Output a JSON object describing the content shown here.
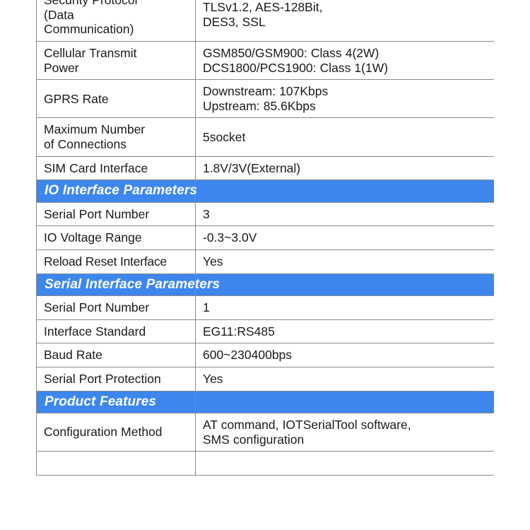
{
  "document": {
    "type": "product-specification-table",
    "accent_color": "#3d86ee",
    "border_color": "#8a8a8a",
    "text_color": "#1a1a1a",
    "banner_text_color": "#ffffff"
  },
  "rows": [
    {
      "kind": "spec",
      "label_lines": [
        "Security Protocol",
        "(Data",
        "Communication)"
      ],
      "value_lines": [
        "TLSv1.2, AES-128Bit,",
        "DES3, SSL"
      ]
    },
    {
      "kind": "spec",
      "label_lines": [
        "Cellular Transmit",
        "Power"
      ],
      "value_lines": [
        "GSM850/GSM900: Class 4(2W)",
        "DCS1800/PCS1900: Class 1(1W)"
      ]
    },
    {
      "kind": "spec",
      "label_lines": [
        "GPRS Rate"
      ],
      "value_lines": [
        "Downstream: 107Kbps",
        "Upstream: 85.6Kbps"
      ]
    },
    {
      "kind": "spec",
      "label_lines": [
        "Maximum Number",
        "of Connections"
      ],
      "value_lines": [
        "5socket"
      ]
    },
    {
      "kind": "spec",
      "label_lines": [
        "SIM Card Interface"
      ],
      "value_lines": [
        "1.8V/3V(External)"
      ]
    },
    {
      "kind": "section",
      "label_lines": [
        "IO Interface Parameters"
      ],
      "value_lines": [
        ""
      ]
    },
    {
      "kind": "spec",
      "label_lines": [
        "Serial Port Number"
      ],
      "value_lines": [
        "3"
      ]
    },
    {
      "kind": "spec",
      "label_lines": [
        "IO Voltage Range"
      ],
      "value_lines": [
        "-0.3~3.0V"
      ]
    },
    {
      "kind": "spec",
      "tight": true,
      "label_lines": [
        "Reload Reset Interface"
      ],
      "value_lines": [
        "Yes"
      ]
    },
    {
      "kind": "section",
      "label_lines": [
        "Serial Interface Parameters"
      ],
      "value_lines": [
        ""
      ]
    },
    {
      "kind": "spec",
      "label_lines": [
        "Serial Port Number"
      ],
      "value_lines": [
        "1"
      ]
    },
    {
      "kind": "spec",
      "label_lines": [
        "Interface Standard"
      ],
      "value_lines": [
        "EG11:RS485"
      ]
    },
    {
      "kind": "spec",
      "label_lines": [
        "Baud Rate"
      ],
      "value_lines": [
        "600~230400bps"
      ]
    },
    {
      "kind": "spec",
      "label_lines": [
        "Serial Port Protection"
      ],
      "value_lines": [
        "Yes"
      ]
    },
    {
      "kind": "section",
      "label_lines": [
        "Product Features"
      ],
      "value_lines": [
        ""
      ]
    },
    {
      "kind": "spec",
      "label_lines": [
        "Configuration Method"
      ],
      "value_lines": [
        "AT command, IOTSerialTool software,",
        "SMS configuration"
      ]
    },
    {
      "kind": "spec",
      "partial": true,
      "label_lines": [
        ""
      ],
      "value_lines": [
        ""
      ]
    }
  ]
}
